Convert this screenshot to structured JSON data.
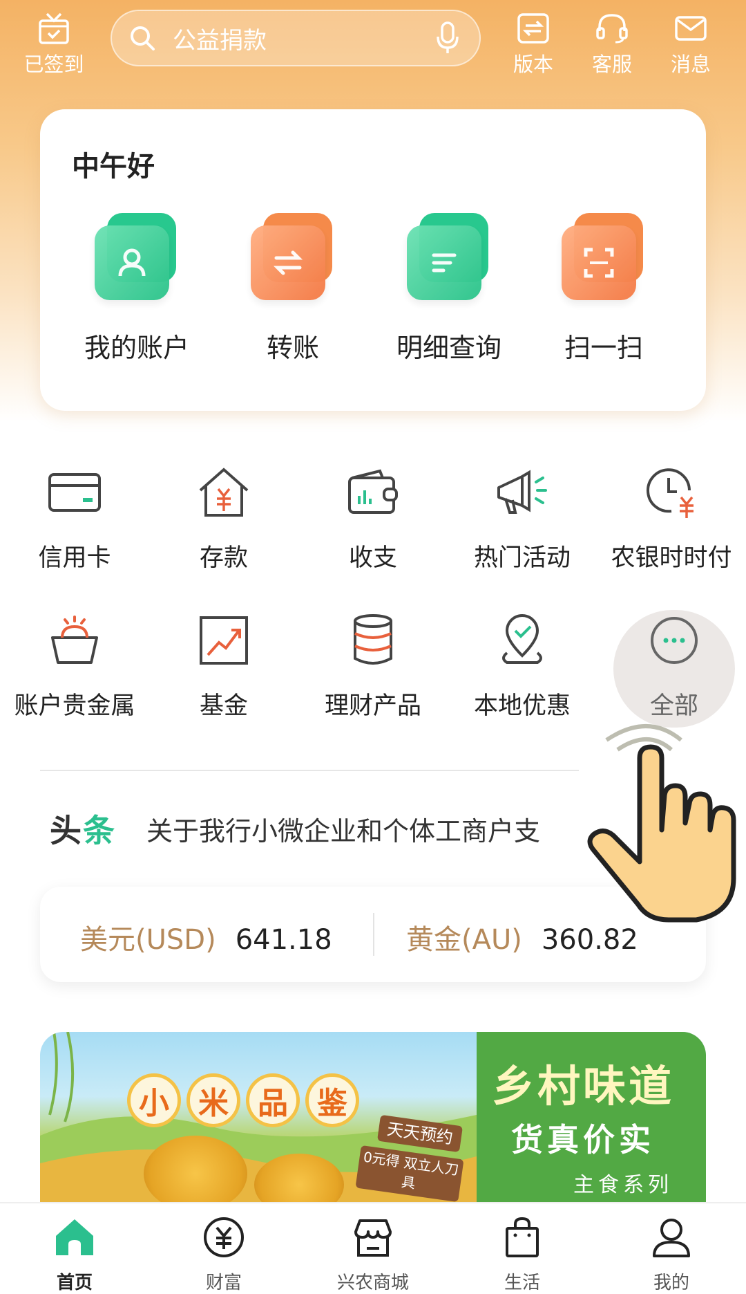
{
  "topbar": {
    "checkin_label": "已签到",
    "search_placeholder": "公益捐款",
    "version_label": "版本",
    "service_label": "客服",
    "message_label": "消息"
  },
  "quick": {
    "greeting": "中午好",
    "items": [
      {
        "label": "我的账户",
        "icon": "account-icon"
      },
      {
        "label": "转账",
        "icon": "transfer-icon"
      },
      {
        "label": "明细查询",
        "icon": "details-icon"
      },
      {
        "label": "扫一扫",
        "icon": "scan-icon"
      }
    ]
  },
  "services": [
    {
      "label": "信用卡",
      "icon": "credit-card-icon"
    },
    {
      "label": "存款",
      "icon": "deposit-icon"
    },
    {
      "label": "收支",
      "icon": "wallet-icon"
    },
    {
      "label": "热门活动",
      "icon": "megaphone-icon"
    },
    {
      "label": "农银时时付",
      "icon": "clock-yen-icon"
    },
    {
      "label": "账户贵金属",
      "icon": "precious-metal-icon"
    },
    {
      "label": "基金",
      "icon": "fund-chart-icon"
    },
    {
      "label": "理财产品",
      "icon": "coins-stack-icon"
    },
    {
      "label": "本地优惠",
      "icon": "location-pin-icon"
    },
    {
      "label": "全部",
      "icon": "more-dots-icon"
    }
  ],
  "news": {
    "tag_a": "头",
    "tag_b": "条",
    "text": "关于我行小微企业和个体工商户支"
  },
  "rates": [
    {
      "name": "美元(USD)",
      "value": "641.18"
    },
    {
      "name": "黄金(AU)",
      "value": "360.82"
    }
  ],
  "banner": {
    "left_badges": [
      "小",
      "米",
      "品",
      "鉴"
    ],
    "sign_1": "天天预约",
    "sign_2": "0元得 双立人刀具",
    "right_title": "乡村味道",
    "right_subtitle": "货真价实",
    "right_tag": "主食系列"
  },
  "nav": {
    "items": [
      {
        "label": "首页",
        "active": true
      },
      {
        "label": "财富",
        "active": false
      },
      {
        "label": "兴农商城",
        "active": false
      },
      {
        "label": "生活",
        "active": false
      },
      {
        "label": "我的",
        "active": false
      }
    ]
  },
  "colors": {
    "accent_green": "#2bbf8e",
    "accent_orange": "#f58a4a",
    "hero_orange": "#f4b264",
    "rate_label": "#b5895a"
  }
}
